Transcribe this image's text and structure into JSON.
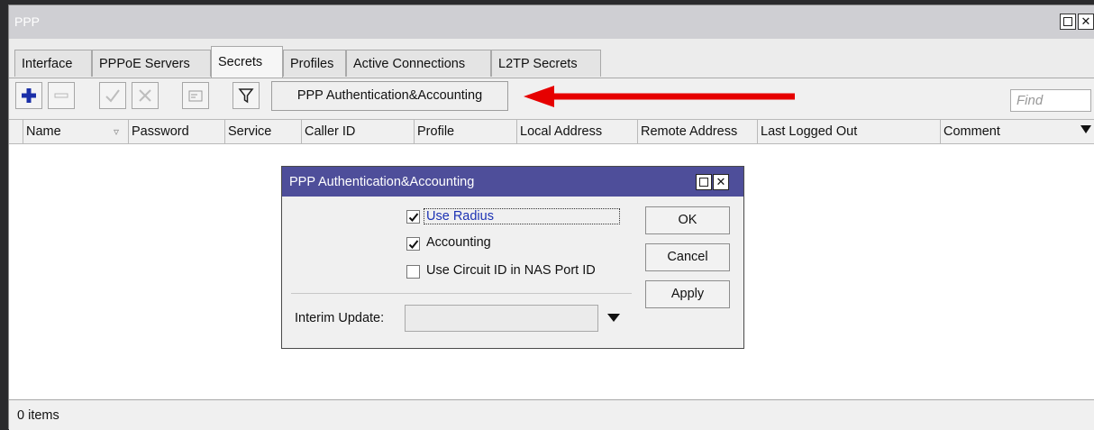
{
  "window": {
    "title": "PPP",
    "tabs": [
      {
        "label": "Interface"
      },
      {
        "label": "PPPoE Servers"
      },
      {
        "label": "Secrets"
      },
      {
        "label": "Profiles"
      },
      {
        "label": "Active Connections"
      },
      {
        "label": "L2TP Secrets"
      }
    ],
    "active_tab": "Secrets"
  },
  "toolbar": {
    "auth_button_label": "PPP Authentication&Accounting",
    "find_placeholder": "Find",
    "icons": [
      "add-icon",
      "remove-icon",
      "enable-icon",
      "disable-icon",
      "comment-icon",
      "filter-icon"
    ],
    "arrow_color": "#e60000"
  },
  "table": {
    "columns": [
      "Name",
      "Password",
      "Service",
      "Caller ID",
      "Profile",
      "Local Address",
      "Remote Address",
      "Last Logged Out",
      "Comment"
    ],
    "rows": []
  },
  "status": {
    "items_text": "0 items"
  },
  "dialog": {
    "title": "PPP Authentication&Accounting",
    "checkboxes": [
      {
        "label": "Use Radius",
        "checked": true
      },
      {
        "label": "Accounting",
        "checked": true
      },
      {
        "label": "Use Circuit ID in NAS Port ID",
        "checked": false
      }
    ],
    "buttons": {
      "ok": "OK",
      "cancel": "Cancel",
      "apply": "Apply"
    },
    "interim_update_label": "Interim Update:",
    "interim_update_value": "",
    "title_bar_color": "#4e4e9a"
  }
}
